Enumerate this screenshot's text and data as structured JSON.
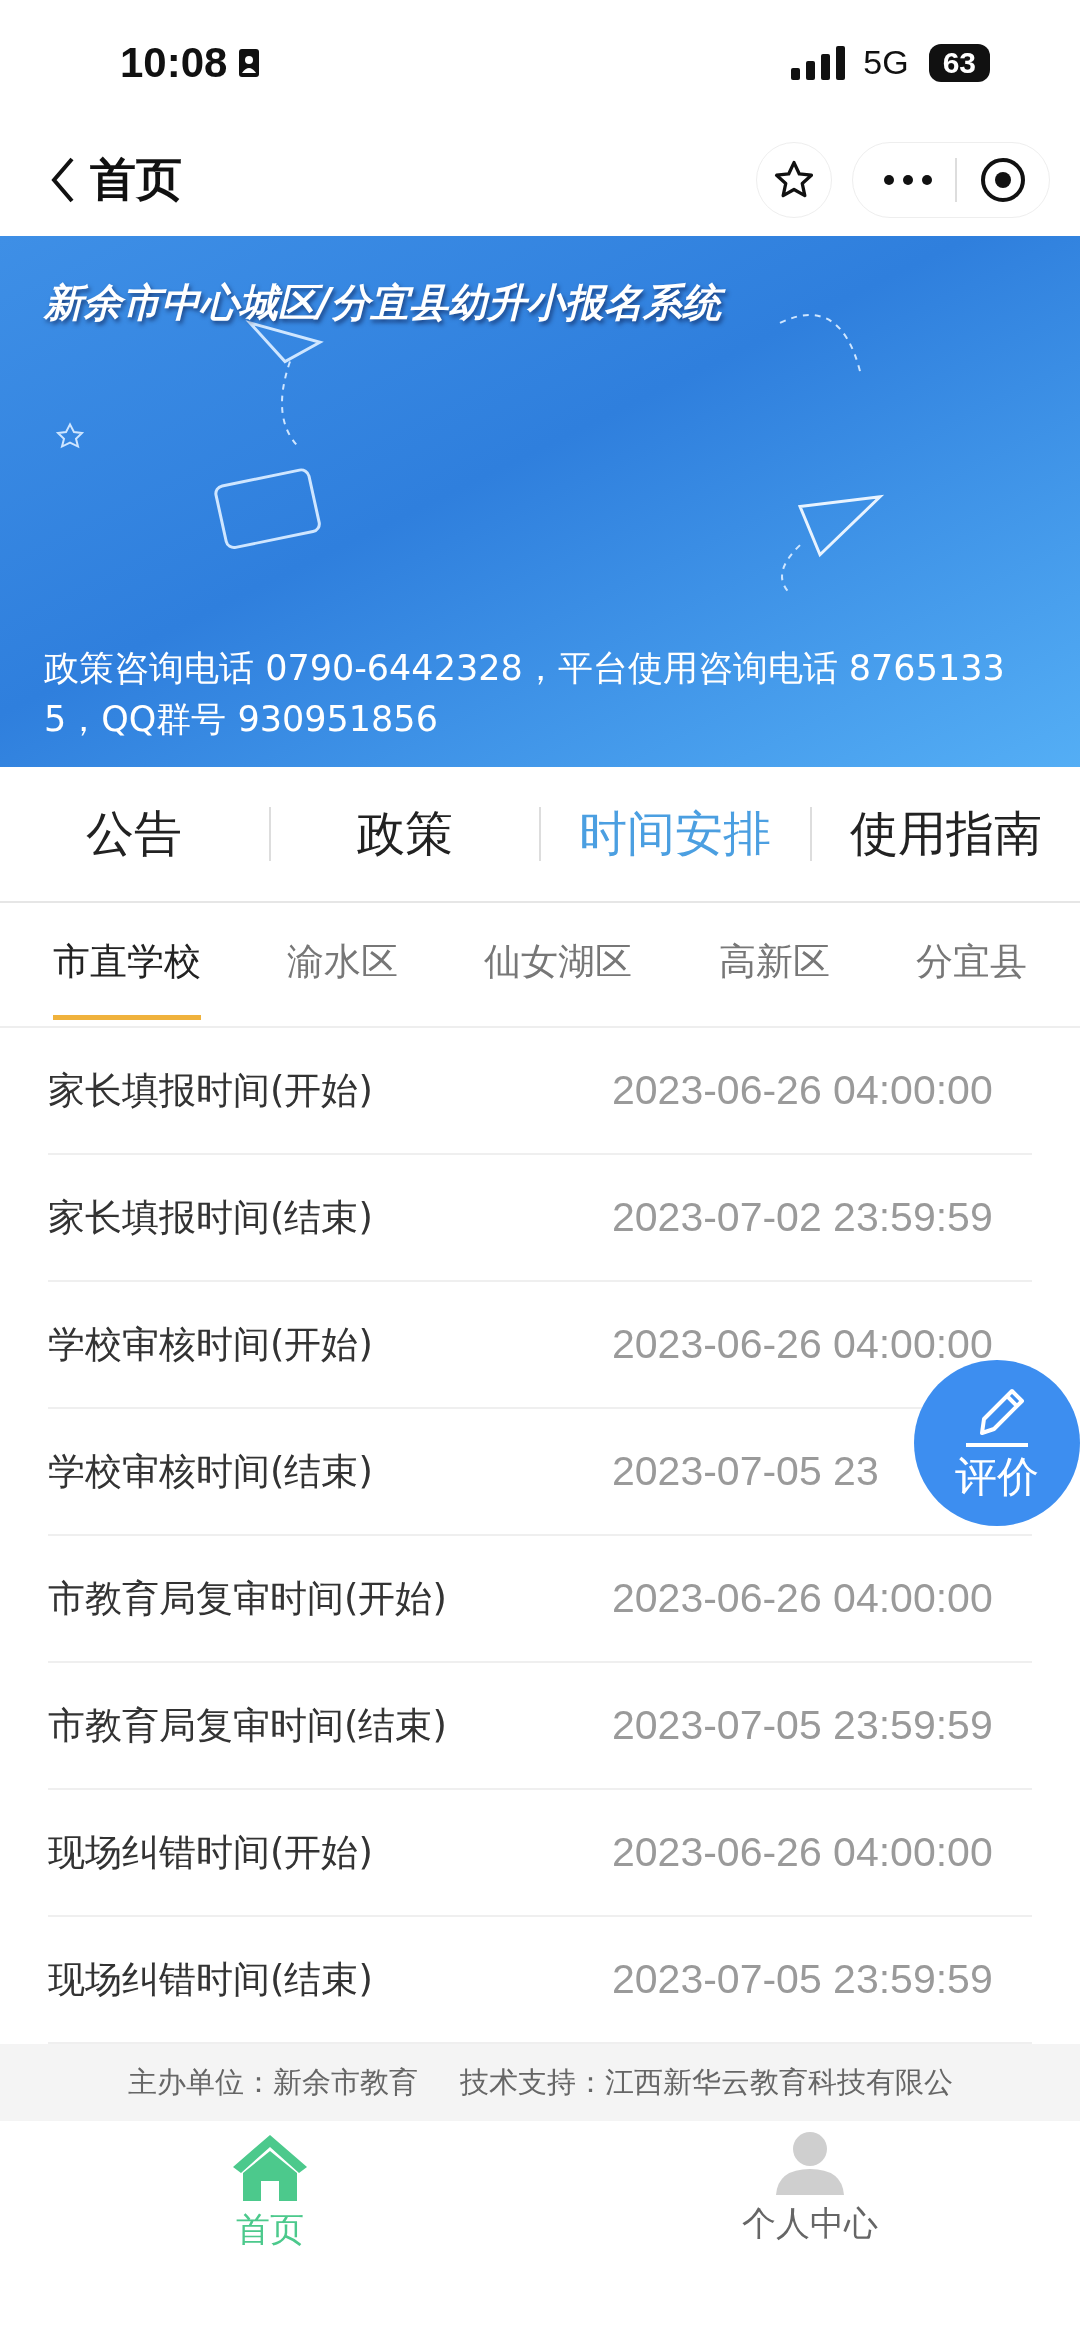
{
  "status_bar": {
    "time": "10:08",
    "network": "5G",
    "battery": "63"
  },
  "nav": {
    "title": "首页"
  },
  "banner": {
    "title": "新余市中心城区/分宜县幼升小报名系统",
    "info": "政策咨询电话 0790-6442328，平台使用咨询电话 87651335，QQ群号 930951856"
  },
  "tabs": [
    {
      "label": "公告",
      "selected": false
    },
    {
      "label": "政策",
      "selected": false
    },
    {
      "label": "时间安排",
      "selected": true
    },
    {
      "label": "使用指南",
      "selected": false
    }
  ],
  "districts": [
    {
      "label": "市直学校",
      "selected": true
    },
    {
      "label": "渝水区",
      "selected": false
    },
    {
      "label": "仙女湖区",
      "selected": false
    },
    {
      "label": "高新区",
      "selected": false
    },
    {
      "label": "分宜县",
      "selected": false
    }
  ],
  "schedule": [
    {
      "name": "家长填报时间(开始)",
      "time": "2023-06-26 04:00:00"
    },
    {
      "name": "家长填报时间(结束)",
      "time": "2023-07-02 23:59:59"
    },
    {
      "name": "学校审核时间(开始)",
      "time": "2023-06-26 04:00:00"
    },
    {
      "name": "学校审核时间(结束)",
      "time": "2023-07-05 23"
    },
    {
      "name": "市教育局复审时间(开始)",
      "time": "2023-06-26 04:00:00"
    },
    {
      "name": "市教育局复审时间(结束)",
      "time": "2023-07-05 23:59:59"
    },
    {
      "name": "现场纠错时间(开始)",
      "time": "2023-06-26 04:00:00"
    },
    {
      "name": "现场纠错时间(结束)",
      "time": "2023-07-05 23:59:59"
    }
  ],
  "float_button": {
    "label": "评价"
  },
  "footer": {
    "sponsor": "主办单位：新余市教育",
    "support": "技术支持：江西新华云教育科技有限公"
  },
  "tab_bar": [
    {
      "label": "首页",
      "selected": true
    },
    {
      "label": "个人中心",
      "selected": false
    }
  ]
}
